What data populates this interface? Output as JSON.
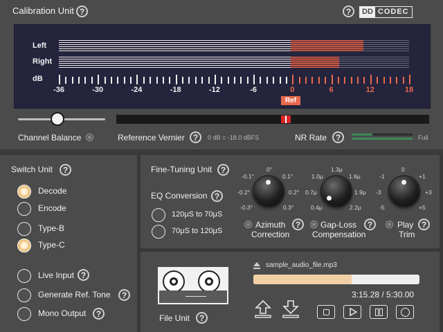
{
  "header": {
    "title": "Calibration Unit",
    "logo_left": "DD",
    "logo_right": "CODEC",
    "help": "?"
  },
  "meter": {
    "left_label": "Left",
    "right_label": "Right",
    "db_label": "dB",
    "scale": [
      "-36",
      "-30",
      "-24",
      "-18",
      "-12",
      "-6",
      "0",
      "6",
      "12",
      "18"
    ],
    "ref_label": "Ref",
    "left_level": 0.87,
    "right_level": 0.8
  },
  "controls": {
    "channel_balance_label": "Channel Balance",
    "reference_vernier_label": "Reference Vernier",
    "reference_vernier_value": "0 dB = -18.0 dBFS",
    "nr_rate_label": "NR Rate",
    "nr_rate_value": "Full",
    "channel_balance_value": 0.5
  },
  "switch_unit": {
    "title": "Switch Unit",
    "options": [
      {
        "label": "Decode",
        "on": true
      },
      {
        "label": "Encode",
        "on": false
      },
      {
        "label": "Type-B",
        "on": false
      },
      {
        "label": "Type-C",
        "on": true
      },
      {
        "label": "Live Input",
        "on": false
      },
      {
        "label": "Generate Ref. Tone",
        "on": false
      },
      {
        "label": "Mono Output",
        "on": false
      }
    ]
  },
  "fine_tuning": {
    "title": "Fine-Tuning Unit",
    "eq_title": "EQ Conversion",
    "eq_options": [
      "120μS to 70μS",
      "70μS to 120μS"
    ],
    "azimuth": {
      "label1": "Azimuth",
      "label2": "Correction",
      "ticks": [
        "0°",
        "-0.1°",
        "0.1°",
        "-0.2°",
        "0.2°",
        "-0.3°",
        "0.3°"
      ]
    },
    "gaploss": {
      "label1": "Gap-Loss",
      "label2": "Compensation",
      "ticks": [
        "1.3μ",
        "1.0μ",
        "1.6μ",
        "0.7μ",
        "1.9μ",
        "0.4μ",
        "2.2μ"
      ]
    },
    "play_trim": {
      "label1": "Play",
      "label2": "Trim",
      "ticks": [
        "0",
        "-1",
        "+1",
        "-3",
        "+3",
        "-5",
        "+5"
      ]
    }
  },
  "file_unit": {
    "title": "File Unit",
    "filename": "sample_audio_file.mp3",
    "time": "3:15.28 / 5:30.00",
    "progress": 0.59
  }
}
